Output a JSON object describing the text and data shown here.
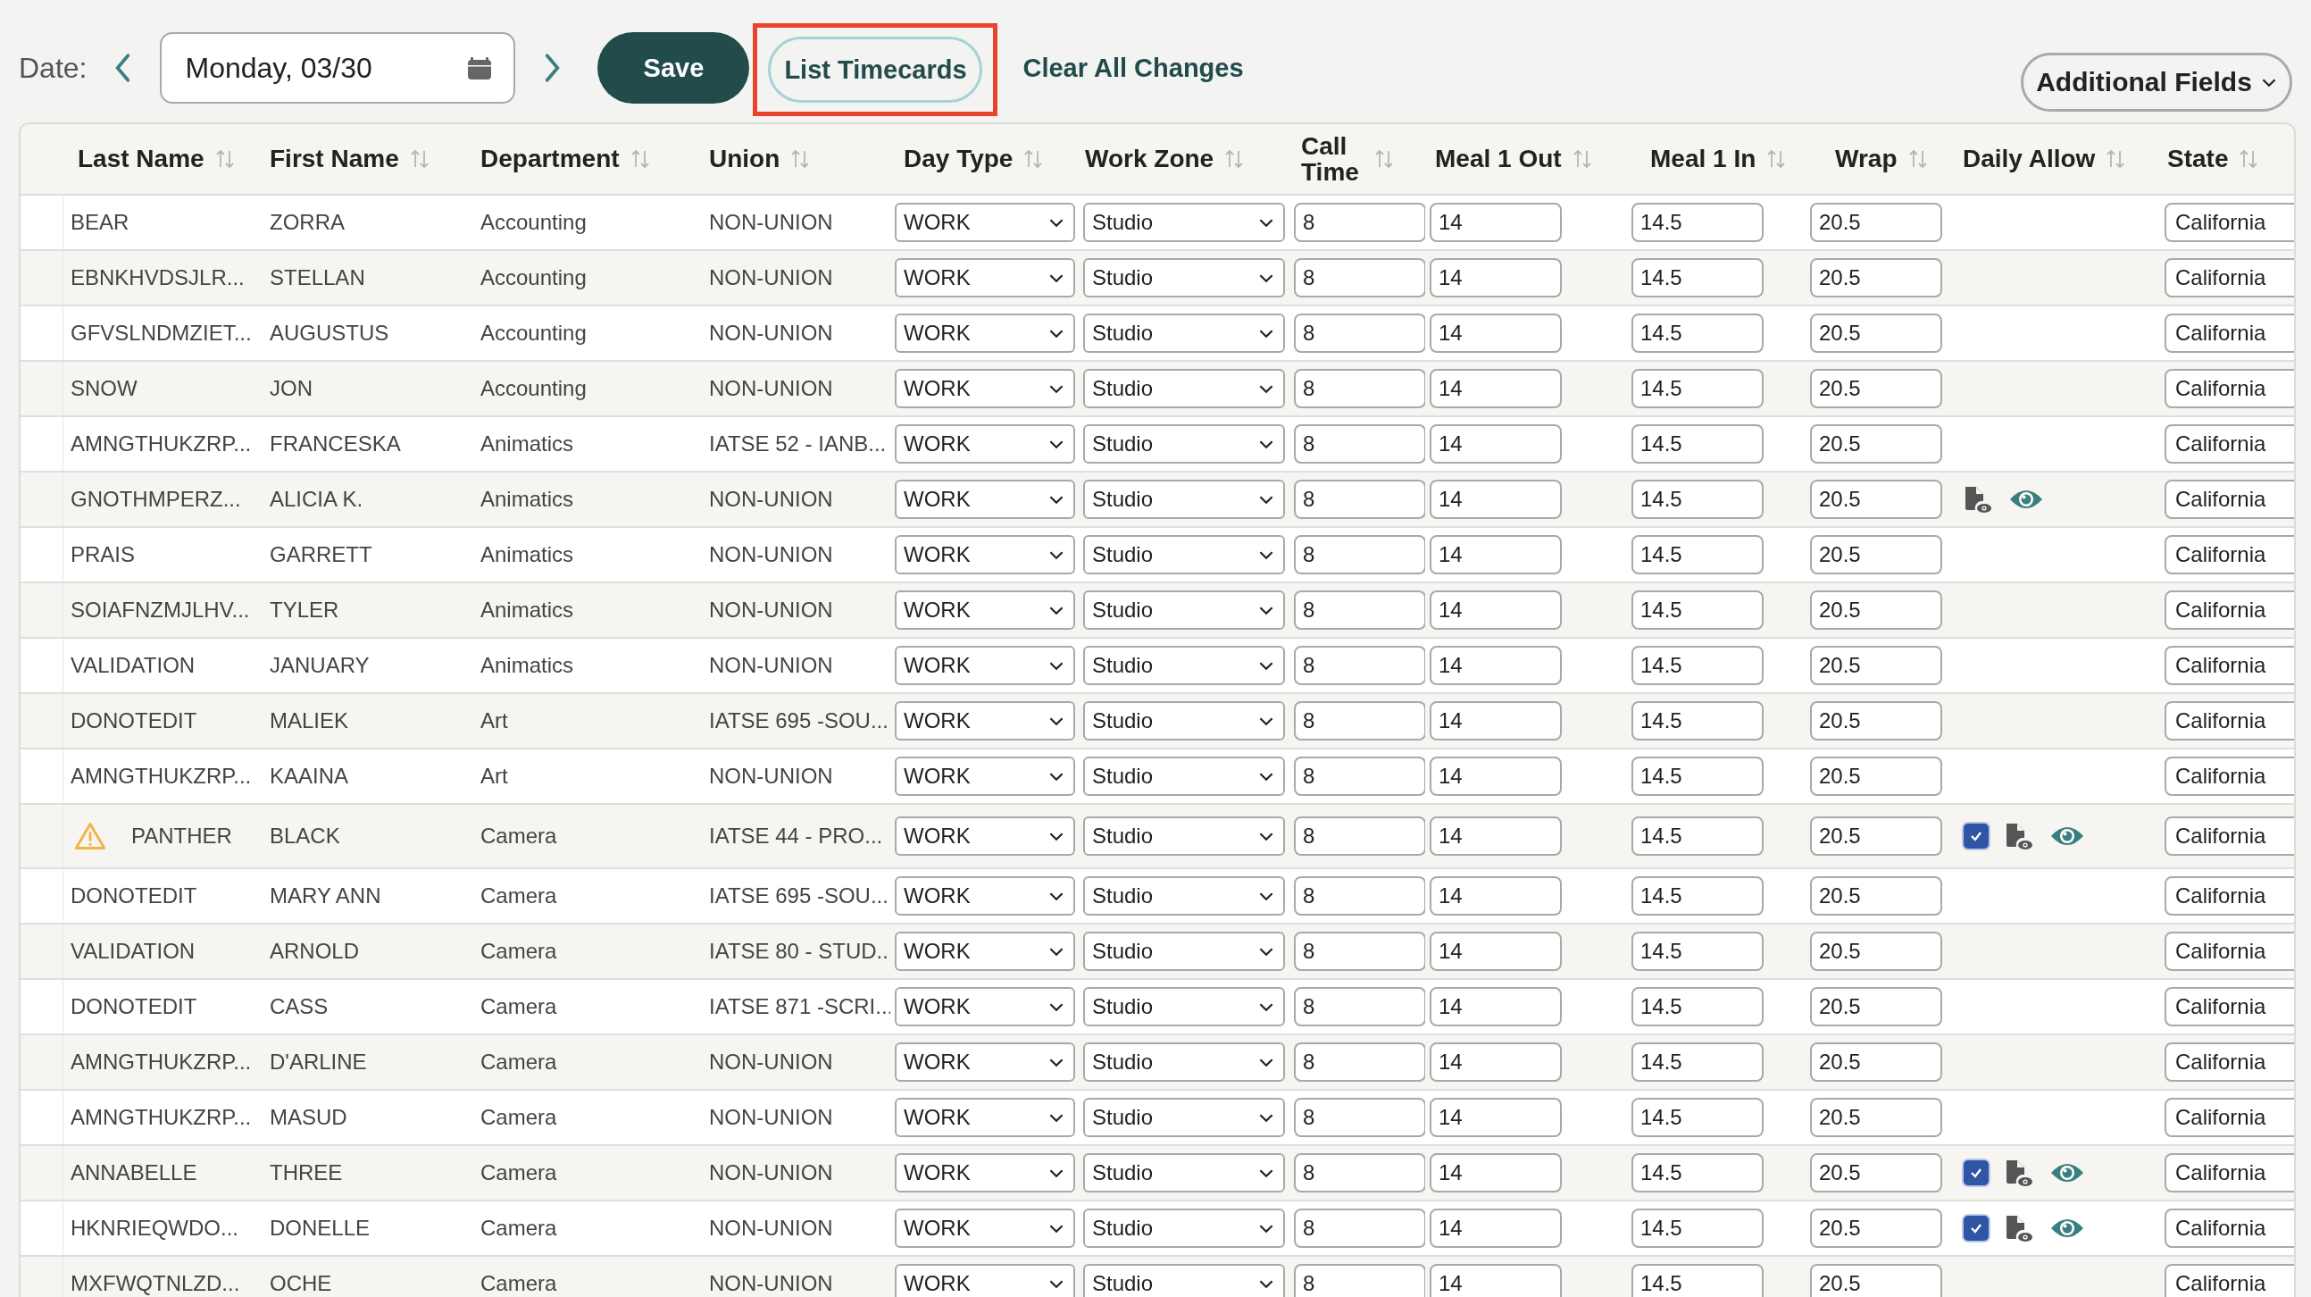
{
  "toolbar": {
    "date_label": "Date:",
    "date_value": "Monday, 03/30",
    "save": "Save",
    "list_timecards": {
      "label": "List Timecards",
      "highlighted": true
    },
    "clear": "Clear All Changes",
    "additional_fields": "Additional Fields"
  },
  "columns": [
    {
      "label": "Last Name"
    },
    {
      "label": "First Name"
    },
    {
      "label": "Department"
    },
    {
      "label": "Union"
    },
    {
      "label": "Day Type"
    },
    {
      "label": "Work Zone"
    },
    {
      "label": "Call Time"
    },
    {
      "label": "Meal 1 Out"
    },
    {
      "label": "Meal 1 In"
    },
    {
      "label": "Wrap"
    },
    {
      "label": "Daily Allow"
    },
    {
      "label": "State"
    }
  ],
  "rows": [
    {
      "last": "BEAR",
      "first": "ZORRA",
      "dept": "Accounting",
      "union": "NON-UNION",
      "day_type": "WORK",
      "work_zone": "Studio",
      "call": "8",
      "meal_out": "14",
      "meal_in": "14.5",
      "wrap": "20.5",
      "state": "California",
      "warning": false
    },
    {
      "last": "EBNKHVDSJLR...",
      "first": "STELLAN",
      "dept": "Accounting",
      "union": "NON-UNION",
      "day_type": "WORK",
      "work_zone": "Studio",
      "call": "8",
      "meal_out": "14",
      "meal_in": "14.5",
      "wrap": "20.5",
      "state": "California",
      "warning": false
    },
    {
      "last": "GFVSLNDMZIET...",
      "first": "AUGUSTUS",
      "dept": "Accounting",
      "union": "NON-UNION",
      "day_type": "WORK",
      "work_zone": "Studio",
      "call": "8",
      "meal_out": "14",
      "meal_in": "14.5",
      "wrap": "20.5",
      "state": "California",
      "warning": false
    },
    {
      "last": "SNOW",
      "first": "JON",
      "dept": "Accounting",
      "union": "NON-UNION",
      "day_type": "WORK",
      "work_zone": "Studio",
      "call": "8",
      "meal_out": "14",
      "meal_in": "14.5",
      "wrap": "20.5",
      "state": "California",
      "warning": false
    },
    {
      "last": "AMNGTHUKZRP...",
      "first": "FRANCESKA",
      "dept": "Animatics",
      "union": "IATSE 52 - IANB...",
      "day_type": "WORK",
      "work_zone": "Studio",
      "call": "8",
      "meal_out": "14",
      "meal_in": "14.5",
      "wrap": "20.5",
      "state": "California",
      "warning": false
    },
    {
      "last": "GNOTHMPERZ...",
      "first": "ALICIA K.",
      "dept": "Animatics",
      "union": "NON-UNION",
      "day_type": "WORK",
      "work_zone": "Studio",
      "call": "8",
      "meal_out": "14",
      "meal_in": "14.5",
      "wrap": "20.5",
      "state": "California",
      "warning": false,
      "allowance": {
        "kind": "view"
      }
    },
    {
      "last": "PRAIS",
      "first": "GARRETT",
      "dept": "Animatics",
      "union": "NON-UNION",
      "day_type": "WORK",
      "work_zone": "Studio",
      "call": "8",
      "meal_out": "14",
      "meal_in": "14.5",
      "wrap": "20.5",
      "state": "California",
      "warning": false
    },
    {
      "last": "SOIAFNZMJLHV...",
      "first": "TYLER",
      "dept": "Animatics",
      "union": "NON-UNION",
      "day_type": "WORK",
      "work_zone": "Studio",
      "call": "8",
      "meal_out": "14",
      "meal_in": "14.5",
      "wrap": "20.5",
      "state": "California",
      "warning": false
    },
    {
      "last": "VALIDATION",
      "first": "JANUARY",
      "dept": "Animatics",
      "union": "NON-UNION",
      "day_type": "WORK",
      "work_zone": "Studio",
      "call": "8",
      "meal_out": "14",
      "meal_in": "14.5",
      "wrap": "20.5",
      "state": "California",
      "warning": false
    },
    {
      "last": "DONOTEDIT",
      "first": "MALIEK",
      "dept": "Art",
      "union": "IATSE 695 -SOU...",
      "day_type": "WORK",
      "work_zone": "Studio",
      "call": "8",
      "meal_out": "14",
      "meal_in": "14.5",
      "wrap": "20.5",
      "state": "California",
      "warning": false
    },
    {
      "last": "AMNGTHUKZRP...",
      "first": "KAAINA",
      "dept": "Art",
      "union": "NON-UNION",
      "day_type": "WORK",
      "work_zone": "Studio",
      "call": "8",
      "meal_out": "14",
      "meal_in": "14.5",
      "wrap": "20.5",
      "state": "California",
      "warning": false
    },
    {
      "last": "PANTHER",
      "first": "BLACK",
      "dept": "Camera",
      "union": "IATSE 44 - PRO...",
      "day_type": "WORK",
      "work_zone": "Studio",
      "call": "8",
      "meal_out": "14",
      "meal_in": "14.5",
      "wrap": "20.5",
      "state": "California",
      "warning": true,
      "allowance": {
        "kind": "check",
        "checked": true
      }
    },
    {
      "last": "DONOTEDIT",
      "first": "MARY ANN",
      "dept": "Camera",
      "union": "IATSE 695 -SOU...",
      "day_type": "WORK",
      "work_zone": "Studio",
      "call": "8",
      "meal_out": "14",
      "meal_in": "14.5",
      "wrap": "20.5",
      "state": "California",
      "warning": false
    },
    {
      "last": "VALIDATION",
      "first": "ARNOLD",
      "dept": "Camera",
      "union": "IATSE 80 - STUD...",
      "day_type": "WORK",
      "work_zone": "Studio",
      "call": "8",
      "meal_out": "14",
      "meal_in": "14.5",
      "wrap": "20.5",
      "state": "California",
      "warning": false
    },
    {
      "last": "DONOTEDIT",
      "first": "CASS",
      "dept": "Camera",
      "union": "IATSE 871 -SCRI...",
      "day_type": "WORK",
      "work_zone": "Studio",
      "call": "8",
      "meal_out": "14",
      "meal_in": "14.5",
      "wrap": "20.5",
      "state": "California",
      "warning": false
    },
    {
      "last": "AMNGTHUKZRP...",
      "first": "D'ARLINE",
      "dept": "Camera",
      "union": "NON-UNION",
      "day_type": "WORK",
      "work_zone": "Studio",
      "call": "8",
      "meal_out": "14",
      "meal_in": "14.5",
      "wrap": "20.5",
      "state": "California",
      "warning": false
    },
    {
      "last": "AMNGTHUKZRP...",
      "first": "MASUD",
      "dept": "Camera",
      "union": "NON-UNION",
      "day_type": "WORK",
      "work_zone": "Studio",
      "call": "8",
      "meal_out": "14",
      "meal_in": "14.5",
      "wrap": "20.5",
      "state": "California",
      "warning": false
    },
    {
      "last": "ANNABELLE",
      "first": "THREE",
      "dept": "Camera",
      "union": "NON-UNION",
      "day_type": "WORK",
      "work_zone": "Studio",
      "call": "8",
      "meal_out": "14",
      "meal_in": "14.5",
      "wrap": "20.5",
      "state": "California",
      "warning": false,
      "allowance": {
        "kind": "check",
        "checked": true
      }
    },
    {
      "last": "HKNRIEQWDO...",
      "first": "DONELLE",
      "dept": "Camera",
      "union": "NON-UNION",
      "day_type": "WORK",
      "work_zone": "Studio",
      "call": "8",
      "meal_out": "14",
      "meal_in": "14.5",
      "wrap": "20.5",
      "state": "California",
      "warning": false,
      "allowance": {
        "kind": "check",
        "checked": true
      }
    },
    {
      "last": "MXFWQTNLZD...",
      "first": "OCHE",
      "dept": "Camera",
      "union": "NON-UNION",
      "day_type": "WORK",
      "work_zone": "Studio",
      "call": "8",
      "meal_out": "14",
      "meal_in": "14.5",
      "wrap": "20.5",
      "state": "California",
      "warning": false
    }
  ]
}
